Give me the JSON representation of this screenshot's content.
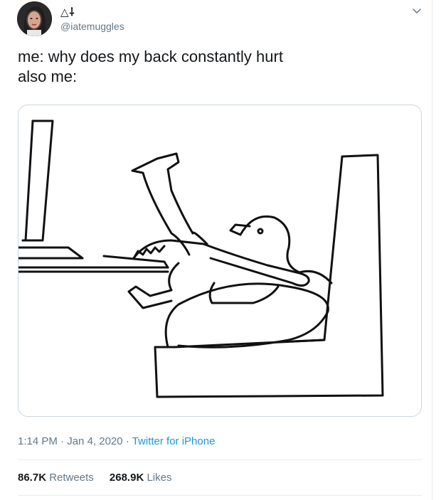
{
  "tweet": {
    "display_name": "△⸸",
    "handle": "@iatemuggles",
    "menu_icon": "chevron-down-icon",
    "text_line1": "me: why does my back constantly hurt",
    "text_line2": "also me:",
    "time": "1:14 PM",
    "date": "Jan 4, 2020",
    "separator": "·",
    "source": "Twitter for iPhone",
    "retweets_count": "86.7K",
    "retweets_label": "Retweets",
    "likes_count": "268.9K",
    "likes_label": "Likes"
  },
  "colors": {
    "text_primary": "#14171a",
    "text_secondary": "#657786",
    "link": "#1b95e0",
    "border": "#e6ecf0"
  }
}
